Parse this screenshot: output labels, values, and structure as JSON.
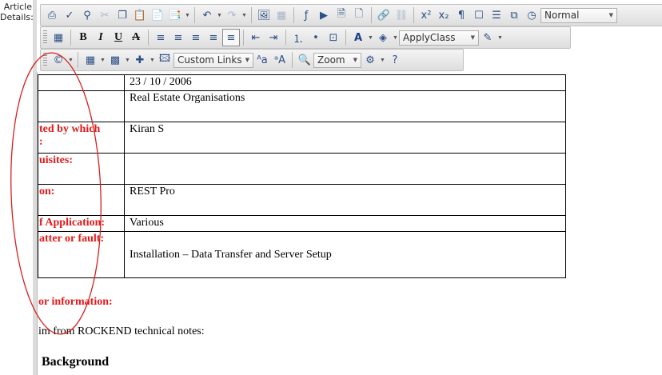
{
  "field_label": {
    "line1": "Article",
    "line2": "Details:"
  },
  "toolbar": {
    "row1": [
      {
        "icon": "print-icon",
        "g": "⎙",
        "dis": false
      },
      {
        "icon": "spellcheck-icon",
        "g": "✓",
        "dis": false
      },
      {
        "icon": "find-icon",
        "g": "⚲",
        "dis": false
      },
      {
        "icon": "cut-icon",
        "g": "✂",
        "dis": true
      },
      {
        "icon": "copy-icon",
        "g": "❐",
        "dis": false
      },
      {
        "icon": "paste-icon",
        "g": "📋",
        "dis": false
      },
      {
        "icon": "paste-text-icon",
        "g": "📄",
        "dis": false
      },
      {
        "icon": "paste-special-icon",
        "g": "📑",
        "dis": false,
        "dropdown": true
      },
      {
        "sep": true
      },
      {
        "icon": "undo-icon",
        "g": "↶",
        "dis": false,
        "dropdown": true
      },
      {
        "icon": "redo-icon",
        "g": "↷",
        "dis": true,
        "dropdown": true
      },
      {
        "sep": true
      },
      {
        "icon": "image-icon",
        "g": "🖼",
        "dis": false
      },
      {
        "icon": "media-icon",
        "g": "▦",
        "dis": true
      },
      {
        "sep": true
      },
      {
        "icon": "flash-icon",
        "g": "ƒ",
        "dis": false
      },
      {
        "icon": "video-icon",
        "g": "▶",
        "dis": false
      },
      {
        "icon": "document-manager-icon",
        "g": "🗎",
        "dis": false
      },
      {
        "icon": "template-icon",
        "g": "🗋",
        "dis": false
      },
      {
        "sep": true
      },
      {
        "icon": "hyperlink-icon",
        "g": "🔗",
        "dis": false
      },
      {
        "icon": "remove-link-icon",
        "g": "⛓",
        "dis": true
      },
      {
        "sep": true
      },
      {
        "icon": "superscript-icon",
        "g": "x²",
        "dis": false
      },
      {
        "icon": "subscript-icon",
        "g": "x₂",
        "dis": false
      },
      {
        "icon": "insert-paragraph-icon",
        "g": "¶",
        "dis": false
      },
      {
        "icon": "form-element-icon",
        "g": "☐",
        "dis": false
      },
      {
        "icon": "line-spacing-icon",
        "g": "☰",
        "dis": false
      },
      {
        "icon": "snippet-icon",
        "g": "⧉",
        "dis": false
      },
      {
        "icon": "clock-icon",
        "g": "◷",
        "dis": false
      },
      {
        "format": true
      }
    ],
    "format_value": "Normal",
    "row2": [
      {
        "grip": true
      },
      {
        "icon": "toggle-borders-icon",
        "g": "▦",
        "dis": false
      },
      {
        "sep": true
      },
      {
        "icon": "bold-icon",
        "g": "B",
        "txt": true
      },
      {
        "icon": "italic-icon",
        "g": "I",
        "txt": true
      },
      {
        "icon": "underline-icon",
        "g": "U",
        "txt": true
      },
      {
        "icon": "strikethrough-icon",
        "g": "A",
        "txt": true
      },
      {
        "sep": true
      },
      {
        "icon": "align-left-icon",
        "g": "≡"
      },
      {
        "icon": "align-center-icon",
        "g": "≡"
      },
      {
        "icon": "align-right-icon",
        "g": "≡"
      },
      {
        "icon": "justify-icon",
        "g": "≡"
      },
      {
        "icon": "remove-alignment-icon",
        "g": "≡",
        "sel": true
      },
      {
        "sep": true
      },
      {
        "icon": "outdent-icon",
        "g": "⇤"
      },
      {
        "icon": "indent-icon",
        "g": "⇥"
      },
      {
        "sep": true
      },
      {
        "icon": "numbered-list-icon",
        "g": "⒈"
      },
      {
        "icon": "bulleted-list-icon",
        "g": "•"
      },
      {
        "icon": "html-mode-icon",
        "g": "⊡"
      },
      {
        "sep": true
      },
      {
        "icon": "font-color-icon",
        "g": "A",
        "dropdown": true
      },
      {
        "icon": "background-color-icon",
        "g": "◈",
        "dropdown": true
      },
      {
        "classdd": true
      },
      {
        "icon": "format-stripper-icon",
        "g": "✎",
        "dropdown": true
      }
    ],
    "class_value": "ApplyClass",
    "row3": [
      {
        "grip": true
      },
      {
        "icon": "symbol-icon",
        "g": "©",
        "dropdown": true
      },
      {
        "sep": true
      },
      {
        "icon": "table-icon",
        "g": "▦",
        "dropdown": true
      },
      {
        "icon": "table-options-icon",
        "g": "▩",
        "dropdown": true
      },
      {
        "icon": "insert-table-row-icon",
        "g": "✚",
        "dropdown": true
      },
      {
        "icon": "image-map-icon",
        "g": "🖾"
      },
      {
        "linksdd": true
      },
      {
        "icon": "decrease-size-icon",
        "g": "ᴬa"
      },
      {
        "icon": "increase-size-icon",
        "g": "ᵃA"
      },
      {
        "sep": true
      },
      {
        "icon": "zoom-icon",
        "g": "🔍"
      },
      {
        "zoomdd": true
      },
      {
        "icon": "module-manager-icon",
        "g": "⚙",
        "dropdown": true
      },
      {
        "icon": "help-icon",
        "g": "?"
      }
    ],
    "links_value": "Custom Links",
    "zoom_value": "Zoom"
  },
  "table_rows": [
    {
      "label": [
        ""
      ],
      "value": "23 / 10 / 2006",
      "h": 20
    },
    {
      "label": [
        ""
      ],
      "value": "Real Estate Organisations",
      "h": 39
    },
    {
      "label": [
        "ted by which",
        ":"
      ],
      "value": "Kiran S",
      "h": 39
    },
    {
      "label": [
        "uisites:"
      ],
      "value": "",
      "h": 39
    },
    {
      "label": [
        "on:"
      ],
      "value": "REST Pro",
      "h": 39
    },
    {
      "label": [
        "f Application:"
      ],
      "value": "Various",
      "h": 20
    },
    {
      "label": [
        "atter or fault:"
      ],
      "value": "Installation – Data Transfer and Server Setup",
      "h": 58,
      "mid": true
    }
  ],
  "red_heading": "or information:",
  "plain_text": "im from ROCKEND technical notes:",
  "bg_heading": "Background"
}
